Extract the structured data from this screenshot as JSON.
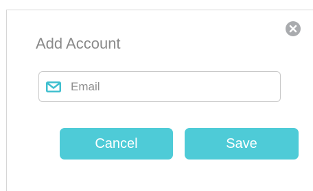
{
  "dialog": {
    "title": "Add Account",
    "close_icon": "close-icon",
    "email_field": {
      "icon": "mail-icon",
      "placeholder": "Email",
      "value": ""
    },
    "buttons": {
      "cancel_label": "Cancel",
      "save_label": "Save"
    }
  },
  "colors": {
    "accent": "#4ecbd7",
    "close_icon": "#a9abae",
    "title_text": "#8a8a8a",
    "field_border": "#c9c9c9"
  }
}
